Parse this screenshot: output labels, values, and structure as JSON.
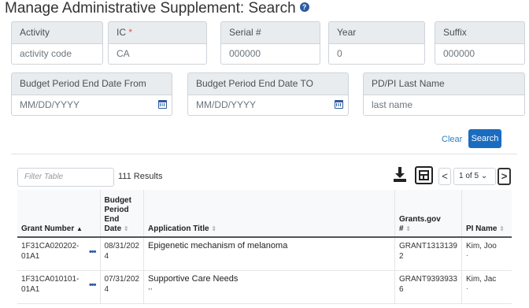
{
  "page": {
    "title": "Manage Administrative Supplement: Search",
    "help_icon": "?"
  },
  "fields": {
    "activity": {
      "label": "Activity",
      "value": "activity code"
    },
    "ic": {
      "label": "IC",
      "required": "*",
      "value": "CA"
    },
    "serial": {
      "label": "Serial #",
      "value": "000000"
    },
    "year": {
      "label": "Year",
      "value": "0"
    },
    "suffix": {
      "label": "Suffix",
      "value": "000000"
    },
    "budget_from": {
      "label": "Budget Period End Date From",
      "value": "MM/DD/YYYY"
    },
    "budget_to": {
      "label": "Budget Period End Date TO",
      "value": "MM/DD/YYYY"
    },
    "pi_last_name": {
      "label": "PD/PI Last Name",
      "value": "last name"
    }
  },
  "actions": {
    "clear": "Clear",
    "search": "Search"
  },
  "results": {
    "filter_placeholder": "Filter Table",
    "count_text": "111 Results",
    "pagination": {
      "prev": "<",
      "page_text": "1 of 5",
      "dropdown": "⌄",
      "next": ">"
    }
  },
  "table": {
    "columns": {
      "grant_number": "Grant Number",
      "budget_line1": "Budget",
      "budget_line2": "Period",
      "budget_line3": "End",
      "budget_line4": "Date",
      "application_title": "Application Title",
      "grants_gov_line1": "Grants.gov",
      "grants_gov_line2": "#",
      "pi_name": "PI Name"
    },
    "sort_up": "▲",
    "sort_both": "⇕",
    "rows": [
      {
        "grant_a": "1F31CA020202-",
        "grant_b": "01A1",
        "actions": "•••",
        "date_a": "08/31/202",
        "date_b": "4",
        "title": "Epigenetic mechanism  of melanoma",
        "title_sub": "",
        "gg_a": "GRANT1313139",
        "gg_b": "2",
        "pi": "Kim, Joo",
        "pi_sub": "."
      },
      {
        "grant_a": "1F31CA010101-",
        "grant_b": "01A1",
        "actions": "•••",
        "date_a": "07/31/202",
        "date_b": "4",
        "title": "Supportive Care Needs",
        "title_sub": ",,",
        "gg_a": "GRANT9393933",
        "gg_b": "6",
        "pi": "Kim, Jac",
        "pi_sub": "."
      }
    ]
  }
}
